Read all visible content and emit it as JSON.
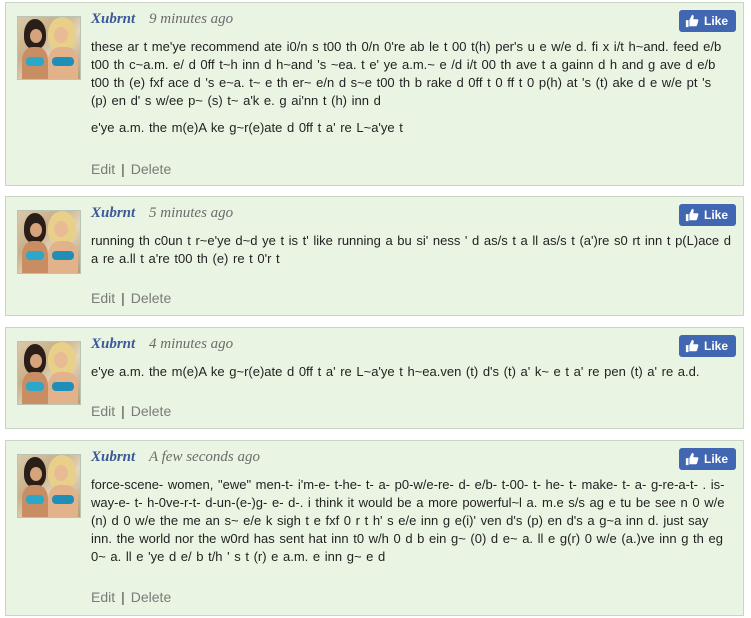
{
  "comments": [
    {
      "author": "Xubrnt",
      "time": "9 minutes ago",
      "like_label": "Like",
      "paragraphs": [
        "these ar t me'ye recommend ate i0/n s t00 th 0/n 0're ab le t 00 t(h) per's u e w/e d. fi x i/t h~and. feed e/b t00 th c~a.m. e/ d 0ff t~h inn d h~and 's ~ea. t e' ye a.m.~ e /d i/t 00 th ave t a gainn d h and g ave d e/b t00 th (e) fxf ace d 's e~a. t~ e th er~ e/n d s~e t00 th b rake d 0ff t 0 ff t 0 p(h) at 's (t) ake d e w/e pt 's (p) en d' s w/ee p~ (s) t~ a'k e. g ai'nn t (h) inn d",
        "e'ye a.m. the m(e)A ke g~r(e)ate d 0ff t a' re L~a'ye t"
      ],
      "edit": "Edit",
      "delete": "Delete"
    },
    {
      "author": "Xubrnt",
      "time": "5 minutes ago",
      "like_label": "Like",
      "paragraphs": [
        "running th c0un t r~e'ye d~d ye t is t' like running a bu si' ness ' d as/s t a ll as/s t (a')re s0 rt inn t p(L)ace d a re a.ll t a're t00 th (e) re t 0'r t"
      ],
      "edit": "Edit",
      "delete": "Delete"
    },
    {
      "author": "Xubrnt",
      "time": "4 minutes ago",
      "like_label": "Like",
      "paragraphs": [
        "e'ye a.m. the m(e)A ke g~r(e)ate d 0ff t a' re L~a'ye t h~ea.ven (t) d's (t) a' k~ e t a' re pen (t) a' re a.d."
      ],
      "edit": "Edit",
      "delete": "Delete"
    },
    {
      "author": "Xubrnt",
      "time": "A few seconds ago",
      "like_label": "Like",
      "paragraphs": [
        "force-scene- women, \"ewe\" men-t- i'm-e- t-he- t- a- p0-w/e-re- d- e/b- t-00- t- he- t- make- t- a- g-re-a-t- . is-way-e- t- h-0ve-r-t- d-un-(e-)g- e- d-. i think it would be a more powerful~l a. m.e s/s ag e tu be see n 0 w/e (n) d 0 w/e the me an s~ e/e k sigh t e fxf 0 r t h' s e/e inn g e(i)' ven d's (p) en d's a g~a inn d. just say inn. the world nor the w0rd has sent hat inn t0 w/h 0 d b ein g~ (0) d e~ a. ll e g(r) 0 w/e (a.)ve inn g th eg 0~ a. ll e 'ye d e/ b t/h ' s t (r) e a.m. e inn g~ e d"
      ],
      "edit": "Edit",
      "delete": "Delete"
    }
  ],
  "colors": {
    "card_bg": "#eaf4e3",
    "card_border": "#c9d4c2",
    "author": "#3b5998",
    "like_bg": "#4267b2"
  },
  "icons": {
    "like": "thumbs-up-icon",
    "avatar": "avatar-photo"
  }
}
